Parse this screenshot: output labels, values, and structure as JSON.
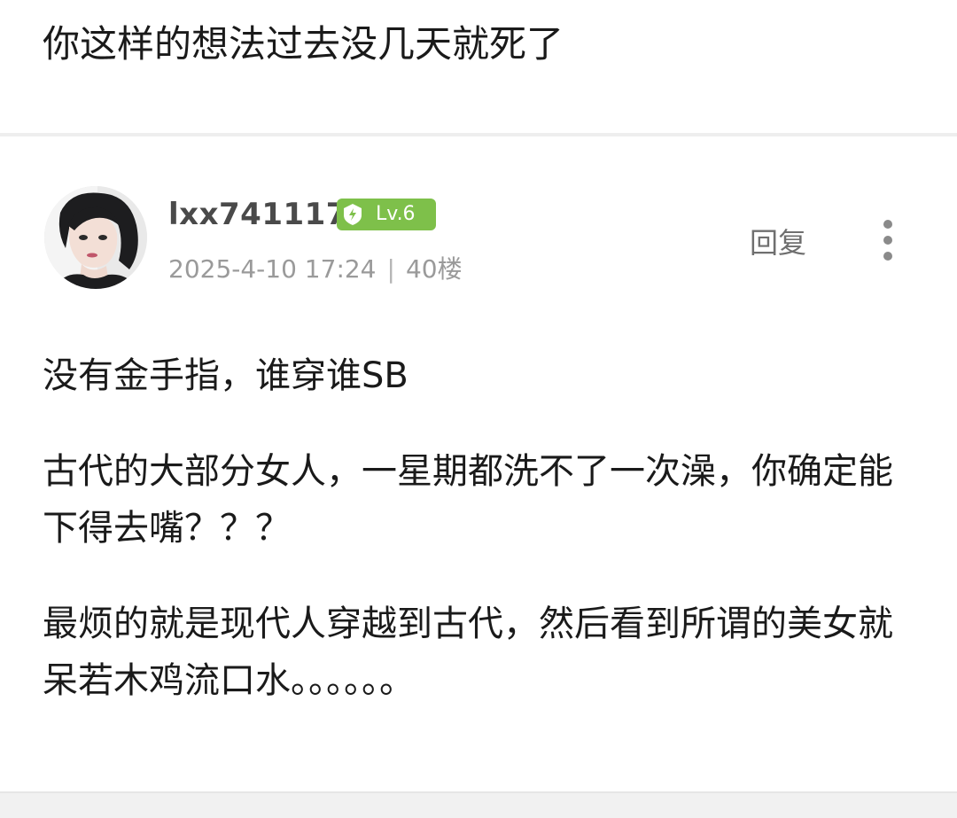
{
  "previous_post": {
    "text": "你这样的想法过去没几天就死了"
  },
  "comment": {
    "username": "lxx741117",
    "level": "Lv.6",
    "date": "2025-4-10 17:24",
    "separator": "|",
    "floor": "40楼",
    "reply_label": "回复",
    "more_icon": "vertical-dots-icon",
    "badge_icon": "level-shield-icon",
    "badge_color": "#7ec04a",
    "paragraphs": [
      "没有金手指，谁穿谁SB",
      "古代的大部分女人，一星期都洗不了一次澡，你确定能下得去嘴？？？",
      "最烦的就是现代人穿越到古代，然后看到所谓的美女就呆若木鸡流口水。。。。。。"
    ]
  }
}
